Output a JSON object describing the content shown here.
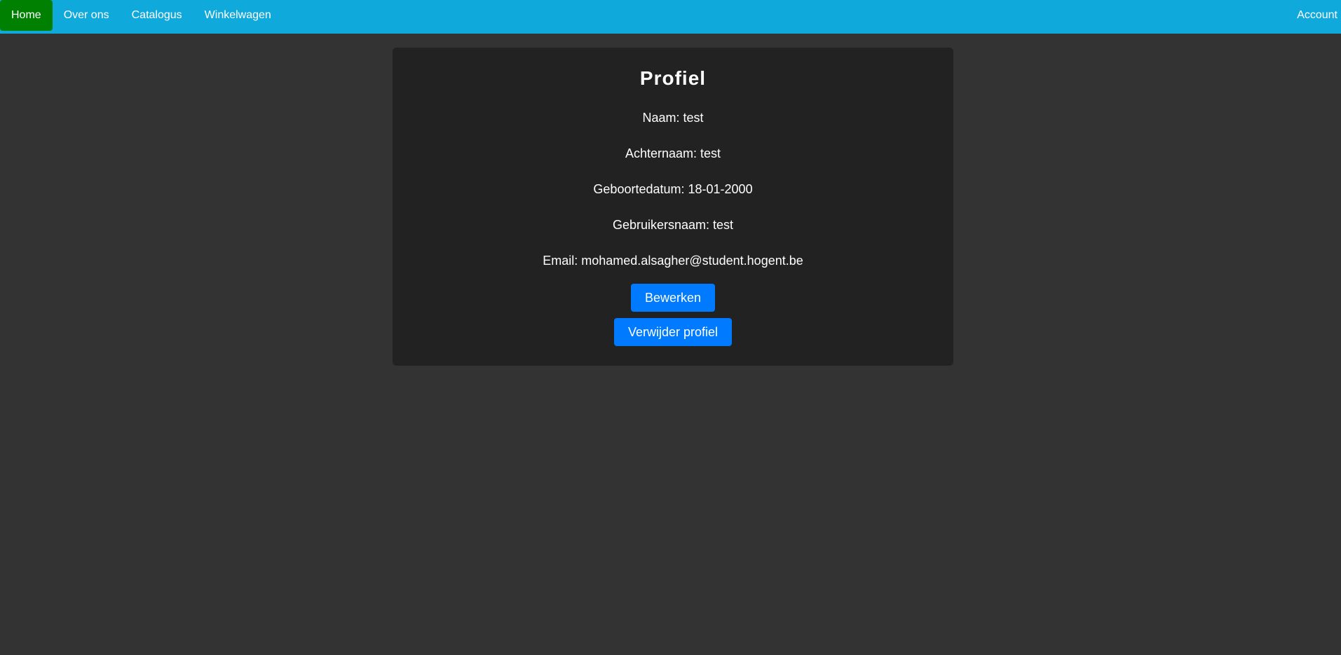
{
  "nav": {
    "items": [
      {
        "label": "Home",
        "active": true
      },
      {
        "label": "Over ons",
        "active": false
      },
      {
        "label": "Catalogus",
        "active": false
      },
      {
        "label": "Winkelwagen",
        "active": false
      }
    ],
    "account_label": "Account"
  },
  "profile": {
    "title": "Profiel",
    "naam": "Naam: test",
    "achternaam": "Achternaam: test",
    "geboortedatum": "Geboortedatum: 18-01-2000",
    "gebruikersnaam": "Gebruikersnaam: test",
    "email": "Email: mohamed.alsagher@student.hogent.be",
    "edit_label": "Bewerken",
    "delete_label": "Verwijder profiel"
  },
  "colors": {
    "navbar": "#10a9dc",
    "active_nav": "#008000",
    "page_bg": "#333333",
    "card_bg": "#222222",
    "button": "#007bff"
  }
}
